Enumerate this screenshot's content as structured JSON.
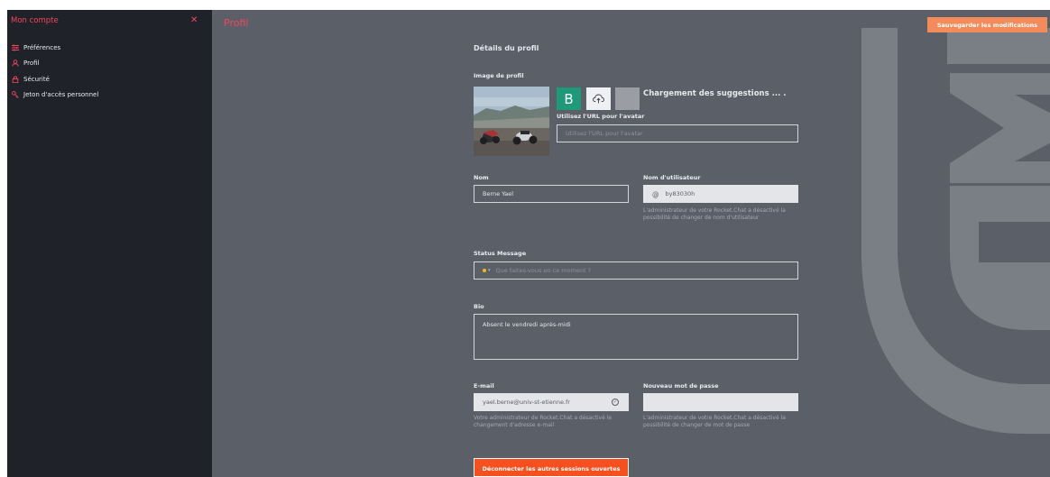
{
  "sidebar": {
    "title": "Mon compte",
    "close_icon": "close-icon",
    "items": [
      {
        "label": "Préférences",
        "icon": "sliders-icon"
      },
      {
        "label": "Profil",
        "icon": "user-icon"
      },
      {
        "label": "Sécurité",
        "icon": "lock-icon"
      },
      {
        "label": "Jeton d'accès personnel",
        "icon": "key-icon"
      }
    ]
  },
  "header": {
    "title": "Profil",
    "save_label": "Sauvegarder les modifications"
  },
  "profile": {
    "section_title": "Détails du profil",
    "avatar_label": "Image de profil",
    "suggestion_letter": "B",
    "loading_text": "Chargement des suggestions ... .",
    "avatar_url_label": "Utilisez l'URL pour l'avatar",
    "avatar_url_placeholder": "Utilisez l'URL pour l'avatar",
    "name_label": "Nom",
    "name_value": "Berne Yael",
    "username_label": "Nom d'utilisateur",
    "username_prefix": "@",
    "username_value": "by83030h",
    "username_help": "L'administrateur de votre Rocket.Chat a désactivé la possibilité de changer de nom d'utilisateur",
    "status_label": "Status Message",
    "status_placeholder": "Que faites-vous en ce moment ?",
    "bio_label": "Bio",
    "bio_value": "Absent le vendredi après-midi",
    "email_label": "E-mail",
    "email_value": "yael.berne@univ-st-etienne.fr",
    "email_help": "Votre administrateur de Rocket.Chat a désactivé le changement d'adresse e-mail",
    "password_label": "Nouveau mot de passe",
    "password_help": "L'administrateur de votre Rocket.Chat a désactivé la possibilité de changer de mot de passe",
    "logout_label": "Déconnecter les autres sessions ouvertes"
  },
  "colors": {
    "accent": "#f5455c",
    "save_button": "#f38c5a",
    "danger_button": "#f5501e",
    "sidebar_bg": "#1f2329",
    "main_bg": "#5b5f67",
    "suggestion_green": "#1e9a7a"
  }
}
